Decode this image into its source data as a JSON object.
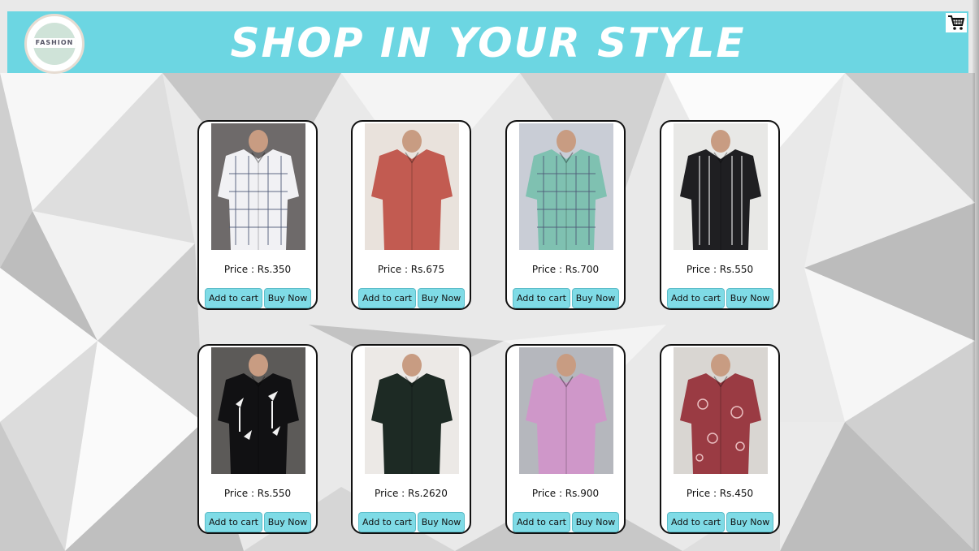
{
  "header": {
    "title": "SHOP IN YOUR STYLE",
    "logo_text": "FASHION",
    "banner_color": "#6cd6e2"
  },
  "cart": {
    "icon": "shopping-cart-icon"
  },
  "buttons": {
    "add_to_cart": "Add to cart",
    "buy_now": "Buy Now"
  },
  "products": [
    {
      "price": "Price : Rs.350",
      "image": "white-checked-shirt",
      "bg": "#6e6a6a",
      "shirt": "#f1f1f4",
      "pattern": "checks"
    },
    {
      "price": "Price : Rs.675",
      "image": "red-plain-shirt",
      "bg": "#e9e2dc",
      "shirt": "#c25b51",
      "pattern": "plain"
    },
    {
      "price": "Price : Rs.700",
      "image": "green-checked-shirt",
      "bg": "#c9cdd6",
      "shirt": "#7fc1b1",
      "pattern": "checks"
    },
    {
      "price": "Price : Rs.550",
      "image": "black-striped-shirt",
      "bg": "#e8e8e6",
      "shirt": "#1f1f22",
      "pattern": "stripes"
    },
    {
      "price": "Price : Rs.550",
      "image": "black-palm-print-shirt",
      "bg": "#5c5a58",
      "shirt": "#111113",
      "pattern": "palms"
    },
    {
      "price": "Price : Rs.2620",
      "image": "dark-green-corduroy-shirt",
      "bg": "#ece9e6",
      "shirt": "#1d2a24",
      "pattern": "plain"
    },
    {
      "price": "Price : Rs.900",
      "image": "lilac-plain-shirt",
      "bg": "#b5b7bd",
      "shirt": "#cf97c9",
      "pattern": "plain"
    },
    {
      "price": "Price : Rs.450",
      "image": "maroon-paisley-shirt",
      "bg": "#d9d6d2",
      "shirt": "#9a3b43",
      "pattern": "paisley"
    }
  ]
}
